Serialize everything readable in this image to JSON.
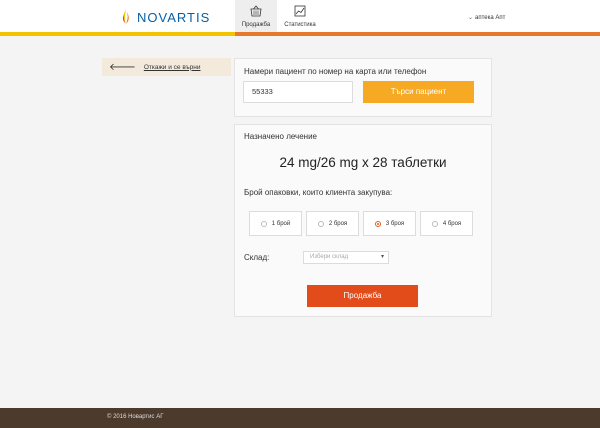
{
  "brand": {
    "logo_text": "NOVARTIS",
    "logo_icon": "flame-logo-icon"
  },
  "nav": {
    "tabs": [
      {
        "label": "Продажба",
        "icon": "basket-icon",
        "active": true
      },
      {
        "label": "Статистика",
        "icon": "chart-icon",
        "active": false
      }
    ],
    "user_label": "аптека Апт"
  },
  "sidebar": {
    "back_label": "Откажи и се върни",
    "back_icon": "arrow-left-icon"
  },
  "search": {
    "title": "Намери пациент по номер на карта или телефон",
    "value": "55333",
    "button_label": "Търси пациент"
  },
  "treatment": {
    "title": "Назначено лечение",
    "dose": "24 mg/26 mg x 28 таблетки",
    "packs_label": "Брой опаковки, които клиента закупува:",
    "options": [
      {
        "label": "1 брой",
        "selected": false
      },
      {
        "label": "2 броя",
        "selected": false
      },
      {
        "label": "3 броя",
        "selected": true
      },
      {
        "label": "4 броя",
        "selected": false
      }
    ],
    "warehouse_label": "Склад:",
    "warehouse_placeholder": "Избери склад",
    "sell_button_label": "Продажба"
  },
  "footer": {
    "copyright": "© 2016 Новартис АГ"
  },
  "colors": {
    "search_button": "#f6a923",
    "sell_button": "#e24b1a",
    "stripe_yellow": "#f4c300",
    "stripe_orange": "#e8782a",
    "footer": "#4c3a2c"
  }
}
